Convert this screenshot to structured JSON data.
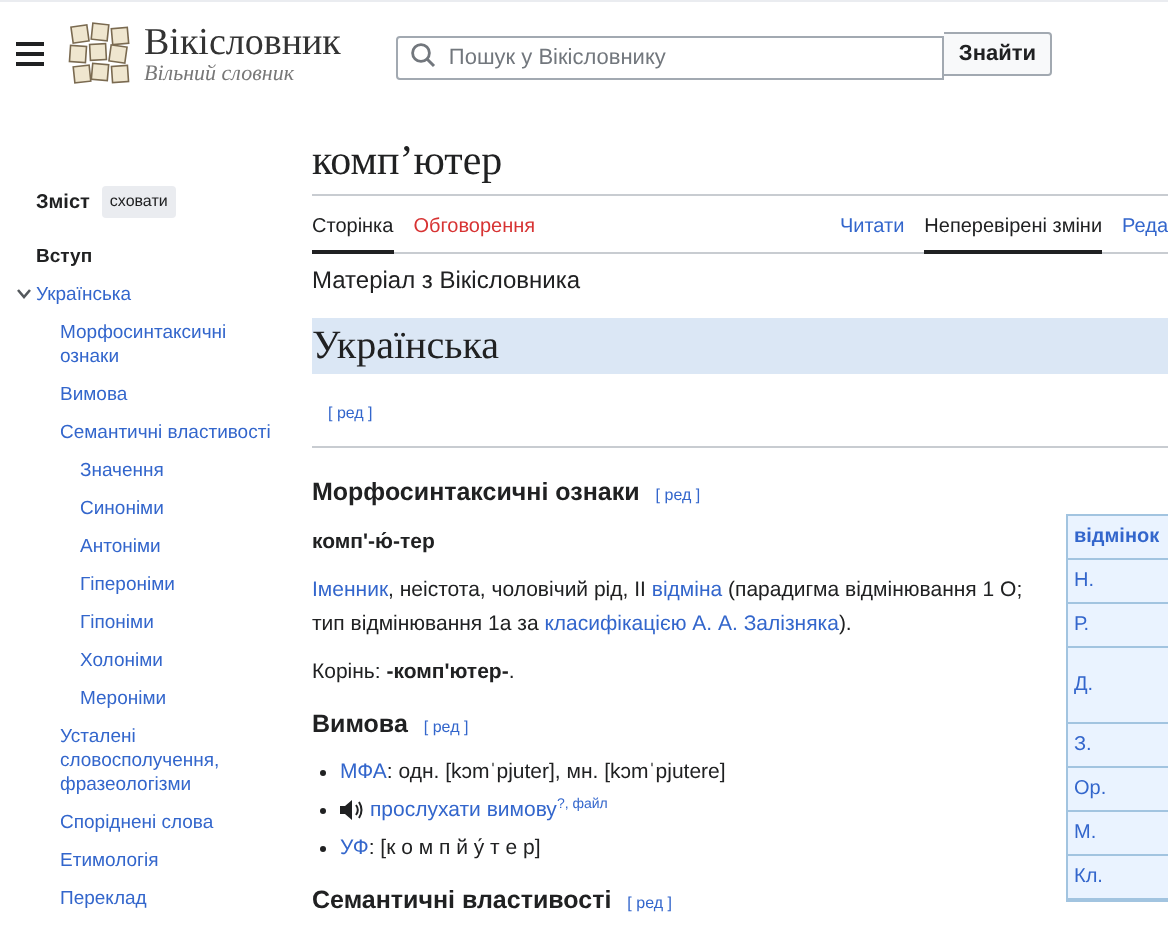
{
  "header": {
    "site_title": "Вікісловник",
    "tagline": "Вільний словник",
    "search": {
      "placeholder": "Пошук у Вікісловнику"
    },
    "search_button": "Знайти"
  },
  "toc": {
    "title": "Зміст",
    "hide_button": "сховати",
    "items": [
      {
        "label": "Вступ",
        "selected": true
      },
      {
        "label": "Українська",
        "selected": false,
        "expanded": true,
        "children": [
          {
            "label": "Морфосинтаксичні ознаки",
            "selected": false
          },
          {
            "label": "Вимова",
            "selected": false
          },
          {
            "label": "Семантичні властивості",
            "selected": false,
            "children": [
              {
                "label": "Значення",
                "selected": false
              },
              {
                "label": "Синоніми",
                "selected": false
              },
              {
                "label": "Антоніми",
                "selected": false
              },
              {
                "label": "Гіпероніми",
                "selected": false
              },
              {
                "label": "Гіпоніми",
                "selected": false
              },
              {
                "label": "Холоніми",
                "selected": false
              },
              {
                "label": "Мероніми",
                "selected": false
              }
            ]
          },
          {
            "label": "Усталені словосполучення, фразеологізми",
            "selected": false
          },
          {
            "label": "Споріднені слова",
            "selected": false
          },
          {
            "label": "Етимологія",
            "selected": false
          },
          {
            "label": "Переклад",
            "selected": false
          }
        ]
      }
    ]
  },
  "page_title": "комп’ютер",
  "tabs_left": [
    {
      "label": "Сторінка",
      "selected": true,
      "missing": false
    },
    {
      "label": "Обговорення",
      "selected": false,
      "missing": true
    }
  ],
  "tabs_right": [
    {
      "label": "Читати",
      "selected": false
    },
    {
      "label": "Неперевірені зміни",
      "selected": true
    },
    {
      "label": "Реда",
      "selected": false
    }
  ],
  "subtitle": "Матеріал з Вікісловника",
  "language_heading": "Українська",
  "language_edit": "[ ред ]",
  "sections": [
    {
      "heading": "Морфосинтаксичні ознаки",
      "edit": "[ ред ]",
      "blocks": [
        {
          "kind": "para",
          "segments": [
            {
              "kind": "bold",
              "text": "комп'-ю́-тер"
            }
          ]
        },
        {
          "kind": "para",
          "segments": [
            {
              "kind": "link",
              "text": "Іменник"
            },
            {
              "kind": "text",
              "text": ", неістота, чоловічий рід, II "
            },
            {
              "kind": "link",
              "text": "відміна"
            },
            {
              "kind": "text",
              "text": " (парадигма відмінювання 1 О; тип відмінювання 1a за "
            },
            {
              "kind": "link",
              "text": "класифікацією А. А. Залізняка"
            },
            {
              "kind": "text",
              "text": ")."
            }
          ]
        },
        {
          "kind": "para",
          "segments": [
            {
              "kind": "text",
              "text": "Корінь: **-комп'ютер-**."
            }
          ]
        }
      ]
    },
    {
      "heading": "Вимова",
      "edit": "[ ред ]",
      "blocks": [
        {
          "kind": "list",
          "items": [
            [
              {
                "kind": "link",
                "text": "МФА"
              },
              {
                "kind": "text",
                "text": ": одн. [kɔmˈpjuter], мн. [kɔmˈpjutere]"
              }
            ],
            [
              {
                "kind": "speaker"
              },
              {
                "kind": "link",
                "text": "прослухати вимову"
              },
              {
                "kind": "sup",
                "text": "?"
              },
              {
                "kind": "suptext",
                "text": ", "
              },
              {
                "kind": "sup",
                "text": "файл"
              }
            ],
            [
              {
                "kind": "link",
                "text": "УФ"
              },
              {
                "kind": "text",
                "text": ": [к о м п й у́ т е р]"
              }
            ]
          ]
        }
      ]
    },
    {
      "heading": "Семантичні властивості",
      "edit": "[ ред ]"
    }
  ],
  "declension_table": {
    "header": "відмінок",
    "rows": [
      "Н.",
      "Р.",
      "Д.",
      "З.",
      "Ор.",
      "М.",
      "Кл."
    ]
  }
}
